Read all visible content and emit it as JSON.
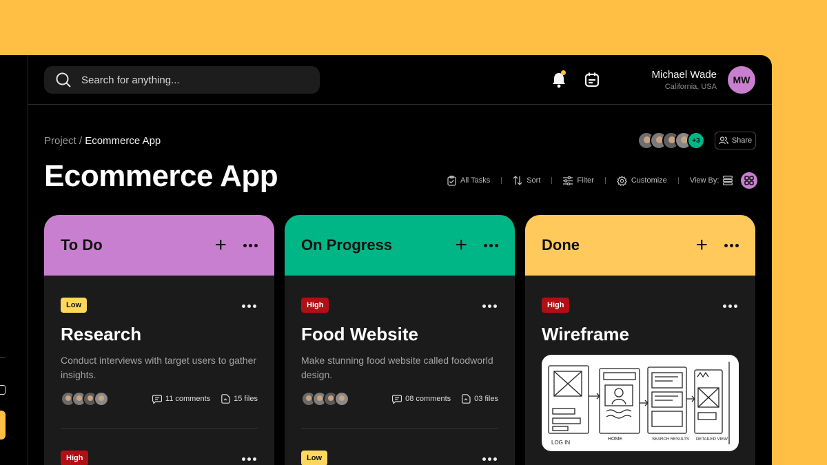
{
  "search": {
    "placeholder": "Search for anything..."
  },
  "user": {
    "name": "Michael Wade",
    "location": "California, USA",
    "initials": "MW"
  },
  "breadcrumb": {
    "root": "Project",
    "separator": " / ",
    "current": "Ecommerce App"
  },
  "page_title": "Ecommerce App",
  "team": {
    "more": "+3",
    "share_label": "Share"
  },
  "toolbar": {
    "all_tasks": "All Tasks",
    "sort": "Sort",
    "filter": "Filter",
    "customize": "Customize",
    "view_by": "View By:"
  },
  "colors": {
    "background": "#FFBF45",
    "todo": "#C97FD0",
    "progress": "#00B586",
    "done": "#FFC95C",
    "high": "#B20F15",
    "low": "#FFD75E"
  },
  "columns": [
    {
      "title": "To Do",
      "cards": [
        {
          "priority": "Low",
          "title": "Research",
          "description": "Conduct interviews with target users to gather insights.",
          "comments": "11 comments",
          "files": "15 files"
        },
        {
          "priority": "High"
        }
      ]
    },
    {
      "title": "On Progress",
      "cards": [
        {
          "priority": "High",
          "title": "Food Website",
          "description": "Make stunning food website called foodworld design.",
          "comments": "08 comments",
          "files": "03 files"
        },
        {
          "priority": "Low"
        }
      ]
    },
    {
      "title": "Done",
      "cards": [
        {
          "priority": "High",
          "title": "Wireframe",
          "sketch_labels": [
            "LOG IN",
            "HOME",
            "SEARCH RESULTS",
            "DETAILED VIEW"
          ]
        }
      ]
    }
  ]
}
